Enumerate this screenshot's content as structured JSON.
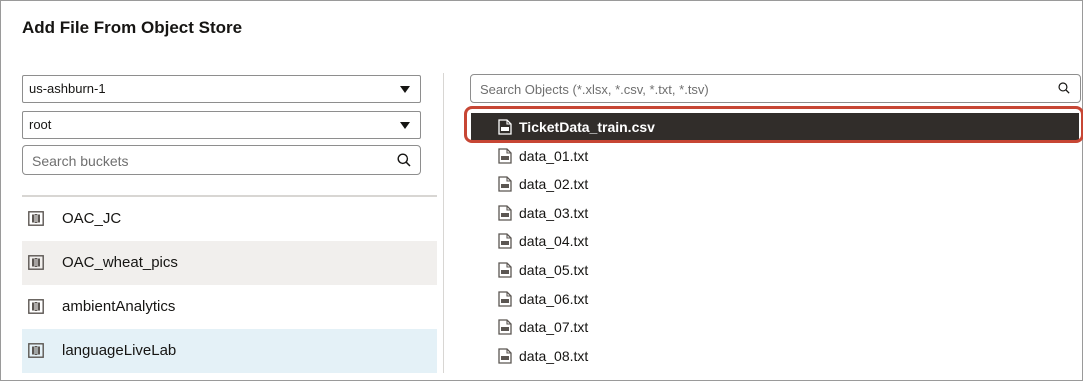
{
  "dialog": {
    "title": "Add File From Object Store"
  },
  "left_panel": {
    "region_select": {
      "value": "us-ashburn-1"
    },
    "compartment_select": {
      "value": "root"
    },
    "bucket_search": {
      "placeholder": "Search buckets",
      "value": ""
    },
    "buckets": [
      {
        "label": "OAC_JC",
        "icon": "bucket-icon"
      },
      {
        "label": "OAC_wheat_pics",
        "icon": "bucket-icon"
      },
      {
        "label": "ambientAnalytics",
        "icon": "bucket-icon"
      },
      {
        "label": "languageLiveLab",
        "icon": "bucket-icon",
        "selected": true
      }
    ]
  },
  "right_panel": {
    "object_search": {
      "placeholder": "Search Objects (*.xlsx, *.csv, *.txt, *.tsv)",
      "value": ""
    },
    "files": [
      {
        "name": "TicketData_train.csv",
        "icon": "csv-file-icon",
        "selected": true
      },
      {
        "name": "data_01.txt",
        "icon": "csv-file-icon"
      },
      {
        "name": "data_02.txt",
        "icon": "csv-file-icon"
      },
      {
        "name": "data_03.txt",
        "icon": "csv-file-icon"
      },
      {
        "name": "data_04.txt",
        "icon": "csv-file-icon"
      },
      {
        "name": "data_05.txt",
        "icon": "csv-file-icon"
      },
      {
        "name": "data_06.txt",
        "icon": "csv-file-icon"
      },
      {
        "name": "data_07.txt",
        "icon": "csv-file-icon"
      },
      {
        "name": "data_08.txt",
        "icon": "csv-file-icon"
      }
    ]
  },
  "colors": {
    "highlight_ring": "#c74634",
    "selected_file_bg": "#312d2a",
    "selected_bucket_bg": "#e4f1f7",
    "alt_row_bg": "#f1efed"
  }
}
